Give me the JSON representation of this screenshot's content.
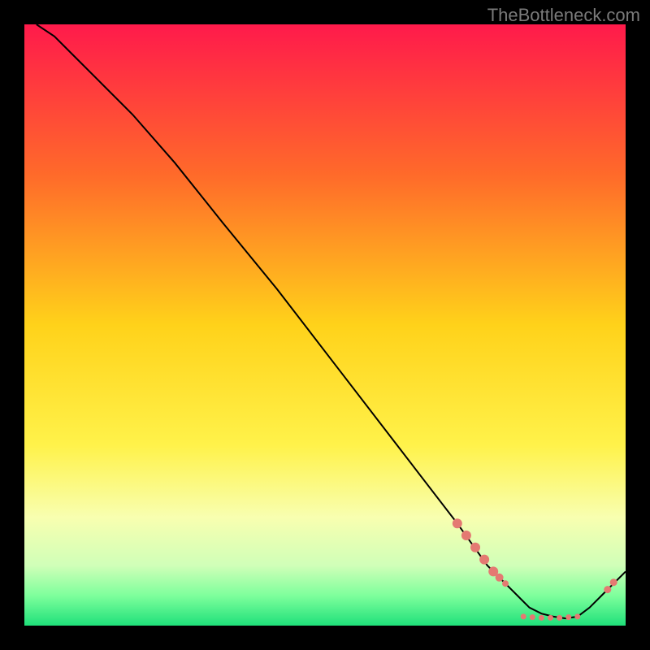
{
  "watermark": "TheBottleneck.com",
  "chart_data": {
    "type": "line",
    "title": "",
    "xlabel": "",
    "ylabel": "",
    "xlim": [
      0,
      100
    ],
    "ylim": [
      0,
      100
    ],
    "grid": false,
    "legend": false,
    "background_gradient": {
      "stops": [
        {
          "pos": 0.0,
          "color": "#ff1a4b"
        },
        {
          "pos": 0.25,
          "color": "#ff6a2a"
        },
        {
          "pos": 0.5,
          "color": "#ffd21a"
        },
        {
          "pos": 0.7,
          "color": "#fff24a"
        },
        {
          "pos": 0.82,
          "color": "#f8ffb0"
        },
        {
          "pos": 0.9,
          "color": "#d0ffb8"
        },
        {
          "pos": 0.95,
          "color": "#7eff9c"
        },
        {
          "pos": 1.0,
          "color": "#1fe07a"
        }
      ]
    },
    "series": [
      {
        "name": "bottleneck-curve",
        "stroke": "#000000",
        "x": [
          2,
          5,
          8,
          12,
          18,
          25,
          33,
          42,
          52,
          62,
          72,
          77,
          80,
          82,
          84,
          86,
          88,
          90,
          92,
          94,
          96,
          98,
          100
        ],
        "y": [
          100,
          98,
          95,
          91,
          85,
          77,
          67,
          56,
          43,
          30,
          17,
          10,
          7,
          5,
          3,
          2,
          1.5,
          1.2,
          1.5,
          3,
          5,
          7,
          9
        ]
      }
    ],
    "markers": [
      {
        "name": "dot",
        "x": 72,
        "y": 17,
        "r": 6,
        "color": "#e47a72"
      },
      {
        "name": "dot",
        "x": 73.5,
        "y": 15,
        "r": 6,
        "color": "#e47a72"
      },
      {
        "name": "dot",
        "x": 75,
        "y": 13,
        "r": 6,
        "color": "#e47a72"
      },
      {
        "name": "dot",
        "x": 76.5,
        "y": 11,
        "r": 6,
        "color": "#e47a72"
      },
      {
        "name": "dot",
        "x": 78,
        "y": 9,
        "r": 6,
        "color": "#e47a72"
      },
      {
        "name": "dot",
        "x": 79,
        "y": 8,
        "r": 5,
        "color": "#e47a72"
      },
      {
        "name": "dot",
        "x": 80,
        "y": 7,
        "r": 4,
        "color": "#e47a72"
      },
      {
        "name": "dot",
        "x": 83,
        "y": 1.5,
        "r": 3.5,
        "color": "#e47a72"
      },
      {
        "name": "dot",
        "x": 84.5,
        "y": 1.4,
        "r": 3.5,
        "color": "#e47a72"
      },
      {
        "name": "dot",
        "x": 86,
        "y": 1.3,
        "r": 3.5,
        "color": "#e47a72"
      },
      {
        "name": "dot",
        "x": 87.5,
        "y": 1.3,
        "r": 3.5,
        "color": "#e47a72"
      },
      {
        "name": "dot",
        "x": 89,
        "y": 1.3,
        "r": 3.5,
        "color": "#e47a72"
      },
      {
        "name": "dot",
        "x": 90.5,
        "y": 1.4,
        "r": 3.5,
        "color": "#e47a72"
      },
      {
        "name": "dot",
        "x": 92,
        "y": 1.5,
        "r": 3.5,
        "color": "#e47a72"
      },
      {
        "name": "dot",
        "x": 97,
        "y": 6,
        "r": 4.5,
        "color": "#e47a72"
      },
      {
        "name": "dot",
        "x": 98,
        "y": 7.2,
        "r": 4.5,
        "color": "#e47a72"
      }
    ]
  }
}
